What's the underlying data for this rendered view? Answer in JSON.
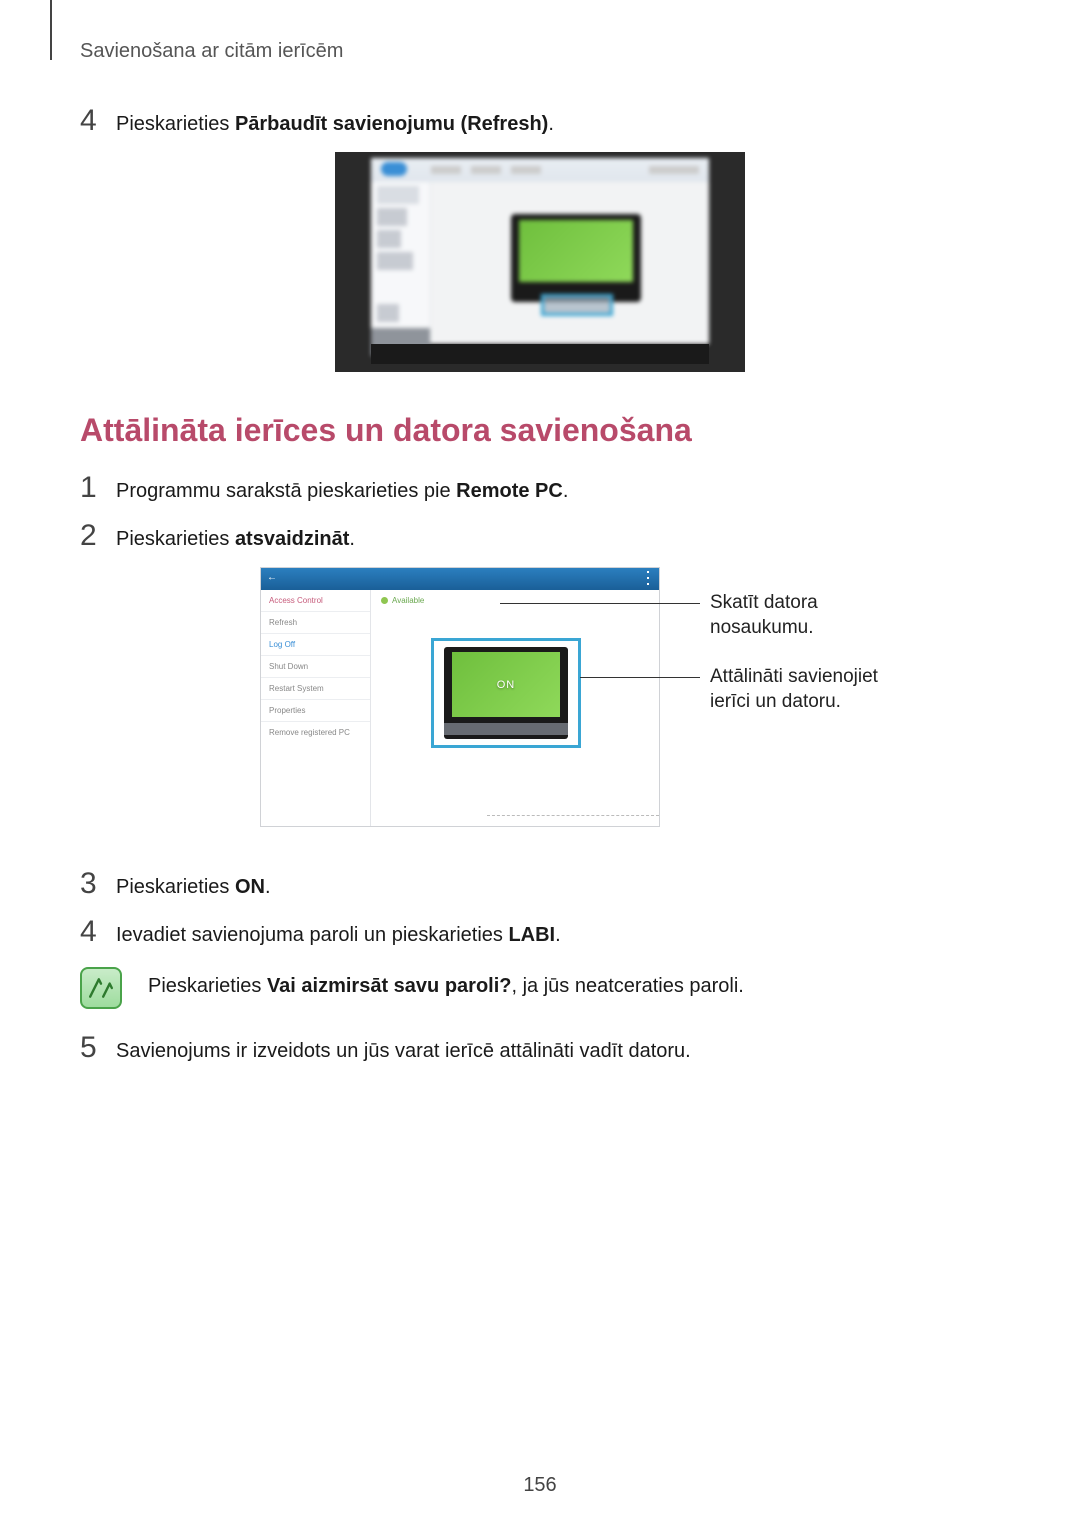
{
  "header": {
    "section_title": "Savienošana ar citām ierīcēm"
  },
  "pre_steps": {
    "step4": {
      "num": "4",
      "prefix": "Pieskarieties ",
      "bold": "Pārbaudīt savienojumu (Refresh)",
      "suffix": "."
    }
  },
  "section_heading": "Attālināta ierīces un datora savienošana",
  "steps": {
    "s1": {
      "num": "1",
      "prefix": "Programmu sarakstā pieskarieties pie ",
      "bold": "Remote PC",
      "suffix": "."
    },
    "s2": {
      "num": "2",
      "prefix": "Pieskarieties ",
      "bold": "atsvaidzināt",
      "suffix": "."
    },
    "s3": {
      "num": "3",
      "prefix": "Pieskarieties ",
      "bold": "ON",
      "suffix": "."
    },
    "s4": {
      "num": "4",
      "prefix": "Ievadiet savienojuma paroli un pieskarieties ",
      "bold": "LABI",
      "suffix": "."
    },
    "s5": {
      "num": "5",
      "text": "Savienojums ir izveidots un jūs varat ierīcē attālināti vadīt datoru."
    }
  },
  "note": {
    "prefix": "Pieskarieties ",
    "bold": "Vai aizmirsāt savu paroli?",
    "suffix": ", ja jūs neatceraties paroli."
  },
  "fig2": {
    "sidebar": {
      "item0": "Access Control",
      "item1": "Refresh",
      "item2": "Log Off",
      "item3": "Shut Down",
      "item4": "Restart System",
      "item5": "Properties",
      "item6": "Remove registered PC"
    },
    "available_label": "Available",
    "on_label": "ON"
  },
  "callouts": {
    "c1_line1": "Skatīt datora",
    "c1_line2": "nosaukumu.",
    "c2_line1": "Attālināti savienojiet",
    "c2_line2": "ierīci un datoru."
  },
  "page_number": "156"
}
